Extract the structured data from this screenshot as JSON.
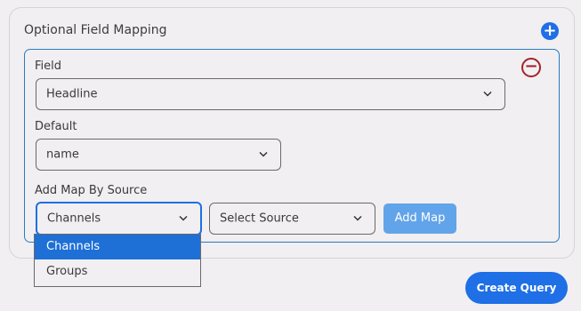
{
  "section": {
    "title": "Optional Field Mapping",
    "add_icon": "plus-circle-icon"
  },
  "mapping": {
    "remove_icon": "minus-circle-icon",
    "field": {
      "label": "Field",
      "value": "Headline"
    },
    "default": {
      "label": "Default",
      "value": "name"
    },
    "add_map_by_source": {
      "label": "Add Map By Source",
      "source_type_value": "Channels",
      "source_value": "Select Source",
      "add_map_label": "Add Map",
      "dropdown_options": [
        "Channels",
        "Groups"
      ]
    }
  },
  "actions": {
    "create_query_label": "Create Query"
  },
  "colors": {
    "accent": "#1f6fe6",
    "remove": "#a3222a",
    "add_map_disabled": "#62a4e9",
    "option_selected": "#1e6fd6"
  }
}
